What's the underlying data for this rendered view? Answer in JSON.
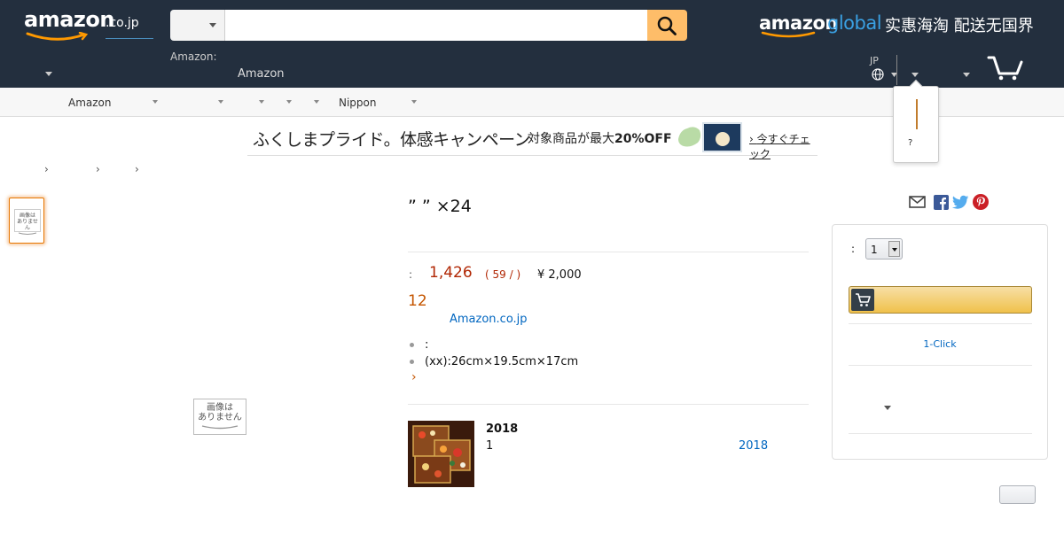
{
  "header": {
    "logo_text": "amazon",
    "logo_suffix": ".co.jp",
    "search_category": "",
    "search_value": "",
    "search_placeholder": "",
    "deliver_label": "Amazon:",
    "deliver_value": "Amazon",
    "global_banner": {
      "amazon": "amazon",
      "global": "global",
      "slogan": "实惠海淘 配送无国界"
    },
    "language": "JP",
    "flyout_text": "?"
  },
  "subnav": {
    "amazon_label": "Amazon",
    "nippon_label": "Nippon"
  },
  "promo": {
    "main_text": "ふくしまプライド。体感キャンペーン",
    "sub_text_prefix": "対象商品が最大",
    "sub_text_off": "20%OFF",
    "check_text": "今すぐチェック"
  },
  "breadcrumb": {
    "separators": [
      "›",
      "›",
      "›"
    ]
  },
  "images": {
    "no_image_text": "画像は ありません",
    "no_image_line1": "画像は",
    "no_image_line2": "ありません"
  },
  "product": {
    "title": "” ” ×24",
    "price_label": ":",
    "price": "1,426",
    "price_unit": "( 59 /  )",
    "list_price": "¥ 2,000",
    "stock": "12",
    "seller": "Amazon.co.jp",
    "features": [
      ":",
      "(xx):26cm×19.5cm×17cm"
    ],
    "more": "›"
  },
  "related": {
    "title": "2018",
    "qty": "1",
    "link": "2018"
  },
  "buybox": {
    "qty_label": ":",
    "qty_value": "1",
    "oneclick_label": "1-Click"
  },
  "colors": {
    "nav_bg": "#232f3e",
    "search_button": "#febd69",
    "price": "#b12704",
    "link": "#0066c0",
    "accent_orange": "#c45500",
    "cart_button": "#f0c14b"
  }
}
